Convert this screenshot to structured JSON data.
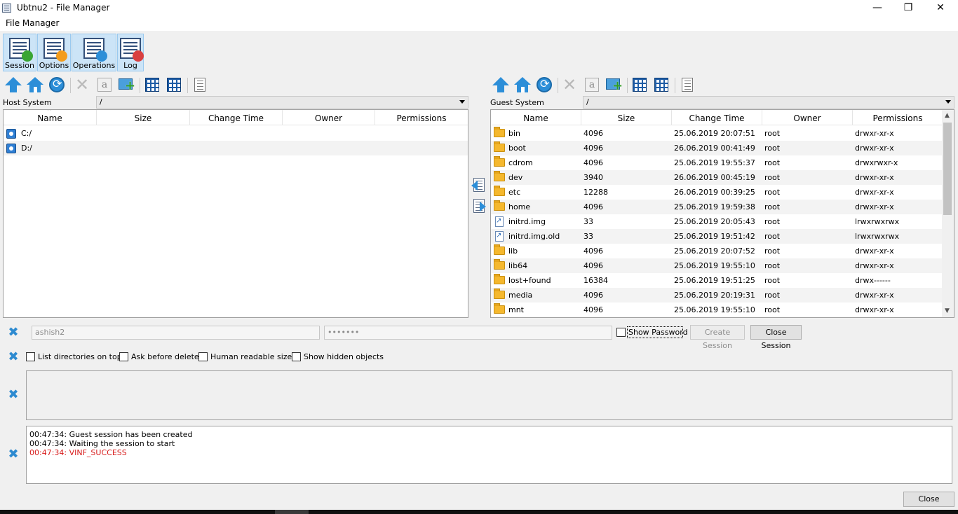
{
  "window": {
    "title": "Ubtnu2 - File Manager",
    "minimize": "—",
    "restore": "❐",
    "close": "✕"
  },
  "menu": {
    "tab": "File Manager"
  },
  "toolbar": {
    "buttons": [
      {
        "label": "Session",
        "icon": "session-icon",
        "badge_color": "#3aa534"
      },
      {
        "label": "Options",
        "icon": "options-gear-icon",
        "badge_color": "#f39c1c"
      },
      {
        "label": "Operations",
        "icon": "operations-cursor-icon",
        "badge_color": "#2c8ed8"
      },
      {
        "label": "Log",
        "icon": "log-icon",
        "badge_color": "#d94040"
      }
    ]
  },
  "host": {
    "label": "Host System",
    "path": "/",
    "columns": [
      "Name",
      "Size",
      "Change Time",
      "Owner",
      "Permissions"
    ],
    "rows": [
      {
        "name": "C:/"
      },
      {
        "name": "D:/"
      }
    ]
  },
  "guest": {
    "label": "Guest System",
    "path": "/",
    "columns": [
      "Name",
      "Size",
      "Change Time",
      "Owner",
      "Permissions"
    ],
    "rows": [
      {
        "type": "folder",
        "name": "bin",
        "size": "4096",
        "time": "25.06.2019 20:07:51",
        "owner": "root",
        "perm": "drwxr-xr-x"
      },
      {
        "type": "folder",
        "name": "boot",
        "size": "4096",
        "time": "26.06.2019 00:41:49",
        "owner": "root",
        "perm": "drwxr-xr-x"
      },
      {
        "type": "folder",
        "name": "cdrom",
        "size": "4096",
        "time": "25.06.2019 19:55:37",
        "owner": "root",
        "perm": "drwxrwxr-x"
      },
      {
        "type": "folder",
        "name": "dev",
        "size": "3940",
        "time": "26.06.2019 00:45:19",
        "owner": "root",
        "perm": "drwxr-xr-x"
      },
      {
        "type": "folder",
        "name": "etc",
        "size": "12288",
        "time": "26.06.2019 00:39:25",
        "owner": "root",
        "perm": "drwxr-xr-x"
      },
      {
        "type": "folder",
        "name": "home",
        "size": "4096",
        "time": "25.06.2019 19:59:38",
        "owner": "root",
        "perm": "drwxr-xr-x"
      },
      {
        "type": "link",
        "name": "initrd.img",
        "size": "33",
        "time": "25.06.2019 20:05:43",
        "owner": "root",
        "perm": "lrwxrwxrwx"
      },
      {
        "type": "link",
        "name": "initrd.img.old",
        "size": "33",
        "time": "25.06.2019 19:51:42",
        "owner": "root",
        "perm": "lrwxrwxrwx"
      },
      {
        "type": "folder",
        "name": "lib",
        "size": "4096",
        "time": "25.06.2019 20:07:52",
        "owner": "root",
        "perm": "drwxr-xr-x"
      },
      {
        "type": "folder",
        "name": "lib64",
        "size": "4096",
        "time": "25.06.2019 19:55:10",
        "owner": "root",
        "perm": "drwxr-xr-x"
      },
      {
        "type": "folder",
        "name": "lost+found",
        "size": "16384",
        "time": "25.06.2019 19:51:25",
        "owner": "root",
        "perm": "drwx------"
      },
      {
        "type": "folder",
        "name": "media",
        "size": "4096",
        "time": "25.06.2019 20:19:31",
        "owner": "root",
        "perm": "drwxr-xr-x"
      },
      {
        "type": "folder",
        "name": "mnt",
        "size": "4096",
        "time": "25.06.2019 19:55:10",
        "owner": "root",
        "perm": "drwxr-xr-x"
      }
    ]
  },
  "session": {
    "username": "ashish2",
    "password": "•••••••",
    "show_password_label": "Show Password",
    "create_label": "Create Session",
    "close_label": "Close Session"
  },
  "options": {
    "list_dirs_on_top": "List directories on top",
    "ask_before_delete": "Ask before delete",
    "human_readable": "Human readable sizes",
    "show_hidden": "Show hidden objects"
  },
  "log": {
    "lines": [
      {
        "text": "00:47:34: Guest session has been created",
        "error": false
      },
      {
        "text": "00:47:34: Waiting the session to start",
        "error": false
      },
      {
        "text": "00:47:34: VINF_SUCCESS",
        "error": true
      }
    ]
  },
  "footer": {
    "close_label": "Close"
  },
  "colors": {
    "accent": "#2c8ed8",
    "error_text": "#d71a1a",
    "folder": "#f5b82e"
  }
}
